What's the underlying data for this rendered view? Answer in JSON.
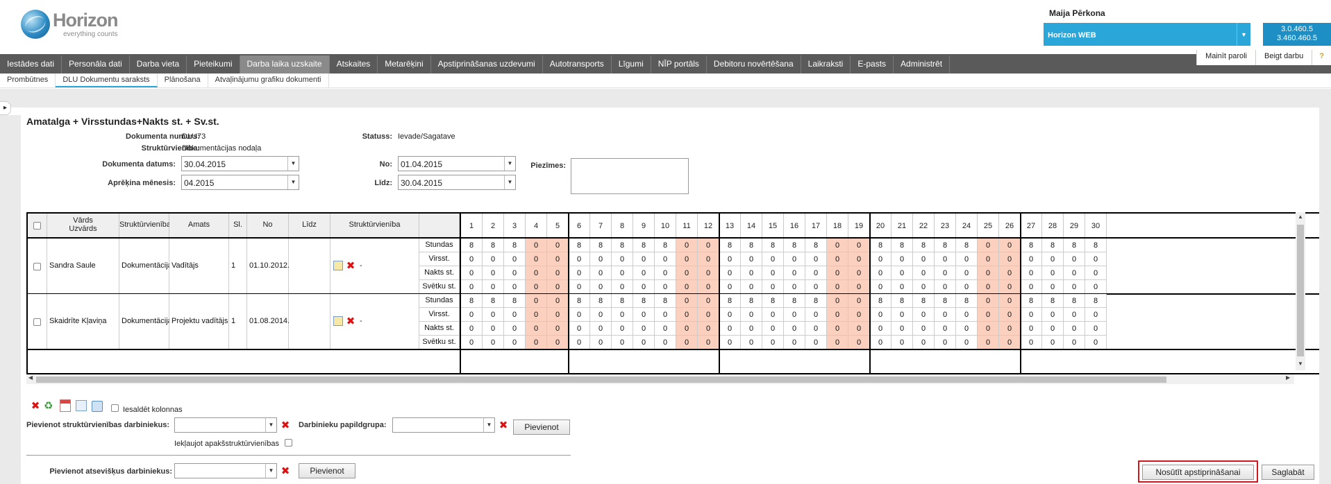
{
  "header": {
    "brand_name": "Horizon",
    "brand_tagline": "everything counts",
    "user_name": "Maija Pērkona",
    "app_name": "Horizon WEB",
    "version_1": "3.0.460.5",
    "version_2": "3.460.460.5"
  },
  "main_nav": [
    "Iestādes dati",
    "Personāla dati",
    "Darba vieta",
    "Pieteikumi",
    "Darba laika uzskaite",
    "Atskaites",
    "Metarēķini",
    "Apstiprināšanas uzdevumi",
    "Autotransports",
    "Līgumi",
    "NĪP portāls",
    "Debitoru novērtēšana",
    "Laikraksti",
    "E-pasts",
    "Administrēt"
  ],
  "right_links": {
    "change_password": "Mainīt paroli",
    "logout": "Beigt darbu",
    "help": "?"
  },
  "sub_nav": [
    "Prombūtnes",
    "DLU Dokumentu saraksts",
    "Plānošana",
    "Atvaļinājumu grafiku dokumenti"
  ],
  "document": {
    "title": "Amatalga + Virsstundas+Nakts st. + Sv.st.",
    "number_label": "Dokumenta numurs:",
    "number": "DLU73",
    "unit_label": "Struktūrvienība:",
    "unit": "Dokumentācijas nodaļa",
    "date_label": "Dokumenta datums:",
    "date": "30.04.2015",
    "month_label": "Aprēķina mēnesis:",
    "month": "04.2015",
    "status_label": "Statuss:",
    "status": "Ievade/Sagatave",
    "from_label": "No:",
    "from": "01.04.2015",
    "to_label": "Līdz:",
    "to": "30.04.2015",
    "notes_label": "Piezīmes:"
  },
  "grid": {
    "headers": {
      "name": "Vārds\nUzvārds",
      "unit": "Struktūrvienība",
      "position": "Amats",
      "rate": "Sl.",
      "from": "No",
      "to": "Līdz",
      "unit2": "Struktūrvienība"
    },
    "days": [
      "1",
      "2",
      "3",
      "4",
      "5",
      "6",
      "7",
      "8",
      "9",
      "10",
      "11",
      "12",
      "13",
      "14",
      "15",
      "16",
      "17",
      "18",
      "19",
      "20",
      "21",
      "22",
      "23",
      "24",
      "25",
      "26",
      "27",
      "28",
      "29",
      "30"
    ],
    "weekend_days": [
      4,
      5,
      11,
      12,
      18,
      19,
      25,
      26
    ],
    "row_types": [
      "Stundas",
      "Virsst.",
      "Nakts st.",
      "Svētku st."
    ],
    "employees": [
      {
        "name": "Sandra Saule",
        "unit": "Dokumentācijas",
        "position": "Vadītājs",
        "rate": "1",
        "from": "01.10.2012.",
        "to": "",
        "unit2": "-",
        "hours": [
          "8",
          "8",
          "8",
          "0",
          "0",
          "8",
          "8",
          "8",
          "8",
          "8",
          "0",
          "0",
          "8",
          "8",
          "8",
          "8",
          "8",
          "0",
          "0",
          "8",
          "8",
          "8",
          "8",
          "8",
          "0",
          "0",
          "8",
          "8",
          "8",
          "8"
        ]
      },
      {
        "name": "Skaidrīte Kļaviņa",
        "unit": "Dokumentācijas",
        "position": "Projektu vadītājs",
        "rate": "1",
        "from": "01.08.2014.",
        "to": "",
        "unit2": "-",
        "hours": [
          "8",
          "8",
          "8",
          "0",
          "0",
          "8",
          "8",
          "8",
          "8",
          "8",
          "0",
          "0",
          "8",
          "8",
          "8",
          "8",
          "8",
          "0",
          "0",
          "8",
          "8",
          "8",
          "8",
          "8",
          "0",
          "0",
          "8",
          "8",
          "8",
          "8"
        ]
      }
    ],
    "zero": "0"
  },
  "footer": {
    "freeze_columns": "Iesaldēt kolonnas",
    "add_unit_employees": "Pievienot struktūrvienības darbiniekus:",
    "extra_group": "Darbinieku papildgrupa:",
    "add_button": "Pievienot",
    "include_subunits": "Iekļaujot apakšstruktūrvienības",
    "add_individual": "Pievienot atsevišķus darbiniekus:",
    "add_button_2": "Pievienot",
    "send_approval": "Nosūtīt apstiprināšanai",
    "save": "Saglabāt"
  },
  "colors": {
    "accent": "#2aa6d9",
    "nav": "#5a5a5a",
    "weekend": "#fbd0be",
    "highlight": "#d0171d"
  }
}
